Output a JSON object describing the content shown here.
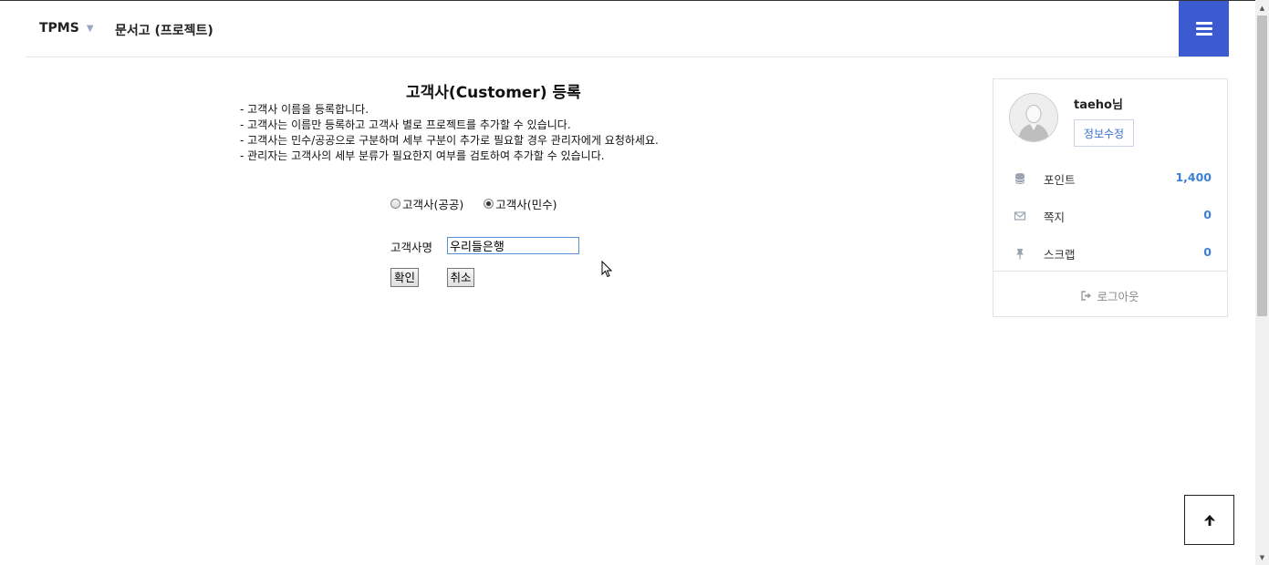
{
  "header": {
    "brand": "TPMS",
    "nav_link": "문서고 (프로젝트)"
  },
  "form": {
    "title": "고객사(Customer) 등록",
    "description": [
      "- 고객사 이름을 등록합니다.",
      "- 고객사는 이름만 등록하고 고객사 별로 프로젝트를 추가할 수 있습니다.",
      "- 고객사는 민수/공공으로 구분하며 세부 구분이 추가로 필요할 경우 관리자에게 요청하세요.",
      "- 관리자는 고객사의 세부 분류가 필요한지 여부를 검토하여 추가할 수 있습니다."
    ],
    "radio_public": "고객사(공공)",
    "radio_private": "고객사(민수)",
    "selected_radio": "고객사(민수)",
    "name_label": "고객사명",
    "name_value": "우리들은행",
    "ok_label": "확인",
    "cancel_label": "취소"
  },
  "profile": {
    "username": "taeho님",
    "edit_label": "정보수정",
    "points_label": "포인트",
    "points_value": "1,400",
    "messages_label": "쪽지",
    "messages_value": "0",
    "scrap_label": "스크랩",
    "scrap_value": "0",
    "logout_label": "로그아웃"
  },
  "colors": {
    "accent": "#3c5bd0",
    "link_blue": "#3c7fd8"
  }
}
